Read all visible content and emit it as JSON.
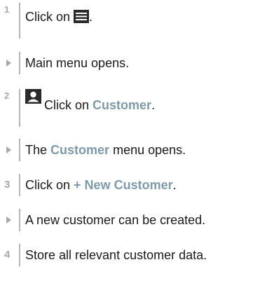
{
  "steps": [
    {
      "number": "1",
      "prefix": "Click on",
      "suffix": "."
    },
    {
      "result": "Main menu opens."
    },
    {
      "number": "2",
      "prefix": "Click on",
      "highlight": "Customer",
      "suffix": "."
    },
    {
      "prefix": "The",
      "highlight": "Customer",
      "suffix": "menu opens."
    },
    {
      "number": "3",
      "prefix": "Click on",
      "highlight": "+ New Customer",
      "suffix": "."
    },
    {
      "result": "A new customer can be created."
    },
    {
      "number": "4",
      "text": "Store all relevant customer data."
    }
  ],
  "icons": {
    "step1": "hamburger-menu-icon",
    "step2": "person-icon",
    "results": "triangle-right-icon"
  },
  "colors": {
    "highlight": "#7f9aa8",
    "marker": "#a8a8a8",
    "text": "#1a1a1a"
  }
}
